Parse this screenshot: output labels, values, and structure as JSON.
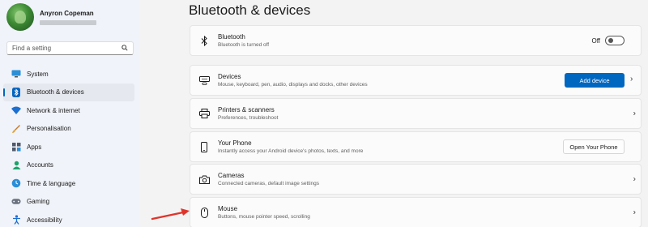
{
  "profile": {
    "name": "Anyron Copeman"
  },
  "search": {
    "placeholder": "Find a setting"
  },
  "sidebar": {
    "items": [
      {
        "label": "System",
        "icon": "monitor-icon"
      },
      {
        "label": "Bluetooth & devices",
        "icon": "bluetooth-icon",
        "active": true
      },
      {
        "label": "Network & internet",
        "icon": "wifi-icon"
      },
      {
        "label": "Personalisation",
        "icon": "brush-icon"
      },
      {
        "label": "Apps",
        "icon": "apps-icon"
      },
      {
        "label": "Accounts",
        "icon": "person-icon"
      },
      {
        "label": "Time & language",
        "icon": "globe-clock-icon"
      },
      {
        "label": "Gaming",
        "icon": "gamepad-icon"
      },
      {
        "label": "Accessibility",
        "icon": "accessibility-icon"
      }
    ]
  },
  "main": {
    "title": "Bluetooth & devices",
    "cards": [
      {
        "title": "Bluetooth",
        "subtitle": "Bluetooth is turned off",
        "icon": "bluetooth-icon",
        "toggle_label": "Off"
      },
      {
        "title": "Devices",
        "subtitle": "Mouse, keyboard, pen, audio, displays and docks, other devices",
        "icon": "keyboard-icon",
        "button": "Add device"
      },
      {
        "title": "Printers & scanners",
        "subtitle": "Preferences, troubleshoot",
        "icon": "printer-icon"
      },
      {
        "title": "Your Phone",
        "subtitle": "Instantly access your Android device's photos, texts, and more",
        "icon": "phone-icon",
        "button": "Open Your Phone"
      },
      {
        "title": "Cameras",
        "subtitle": "Connected cameras, default image settings",
        "icon": "camera-icon"
      },
      {
        "title": "Mouse",
        "subtitle": "Buttons, mouse pointer speed, scrolling",
        "icon": "mouse-icon"
      }
    ]
  },
  "colors": {
    "accent": "#0067c0",
    "arrow": "#e0342b"
  }
}
